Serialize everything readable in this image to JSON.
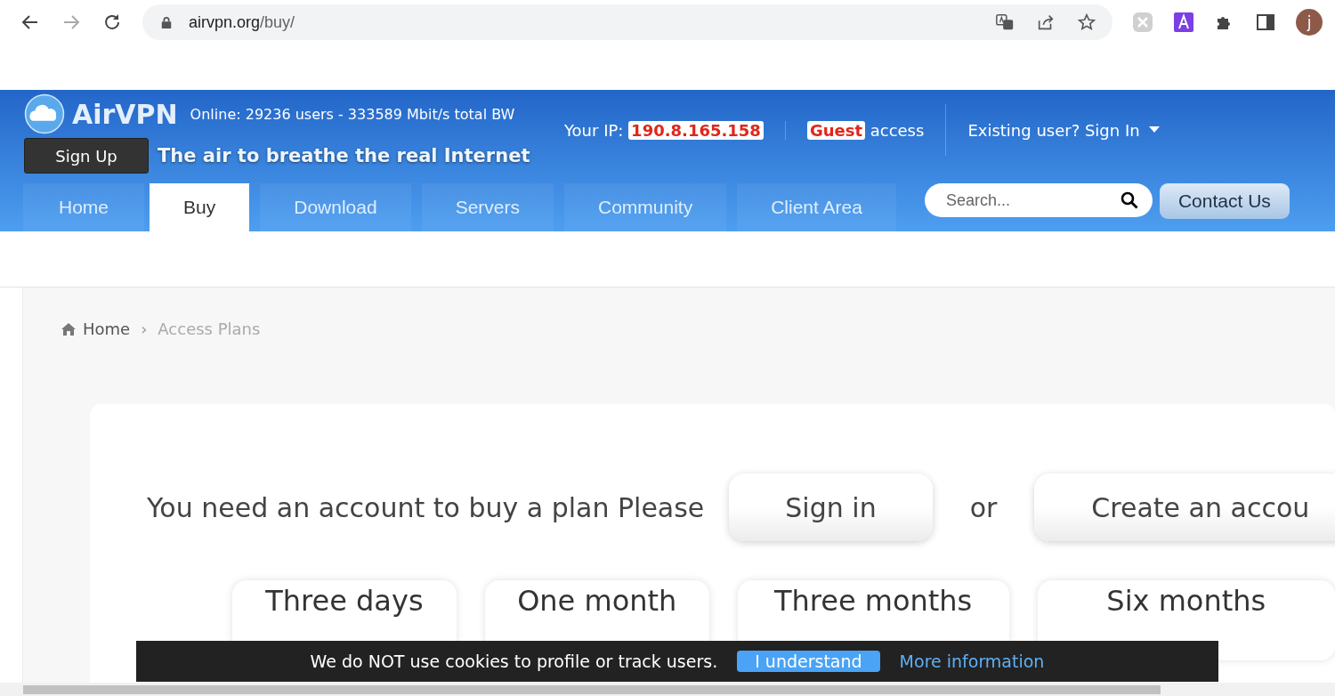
{
  "browser": {
    "url_host": "airvpn.org",
    "url_path": "/buy/",
    "profile_initial": "j"
  },
  "header": {
    "logo": "AirVPN",
    "stats": "Online: 29236 users - 333589 Mbit/s total BW",
    "tagline": "The air to breathe the real Internet",
    "ip_label": "Your IP:",
    "ip": "190.8.165.158",
    "access_role": "Guest",
    "access_label": "access",
    "signin": "Existing user? Sign In",
    "signup": "Sign Up"
  },
  "nav": [
    {
      "label": "Home",
      "selected": false
    },
    {
      "label": "Buy",
      "selected": true
    },
    {
      "label": "Download",
      "selected": false
    },
    {
      "label": "Servers",
      "selected": false
    },
    {
      "label": "Community",
      "selected": false
    },
    {
      "label": "Client Area",
      "selected": false
    }
  ],
  "search": {
    "placeholder": "Search..."
  },
  "contact": "Contact Us",
  "breadcrumb_separator": "›",
  "breadcrumb": [
    {
      "label": "Home",
      "current": false
    },
    {
      "label": "Access Plans",
      "current": true
    }
  ],
  "prompt": {
    "text": "You need an account to buy a plan Please",
    "signin": "Sign in",
    "or": "or",
    "create": "Create an accou"
  },
  "plans": [
    "Three days",
    "One month",
    "Three months",
    "Six months"
  ],
  "cookie": {
    "text": "We do NOT use cookies to profile or track users.",
    "accept": "I understand",
    "more": "More information"
  }
}
